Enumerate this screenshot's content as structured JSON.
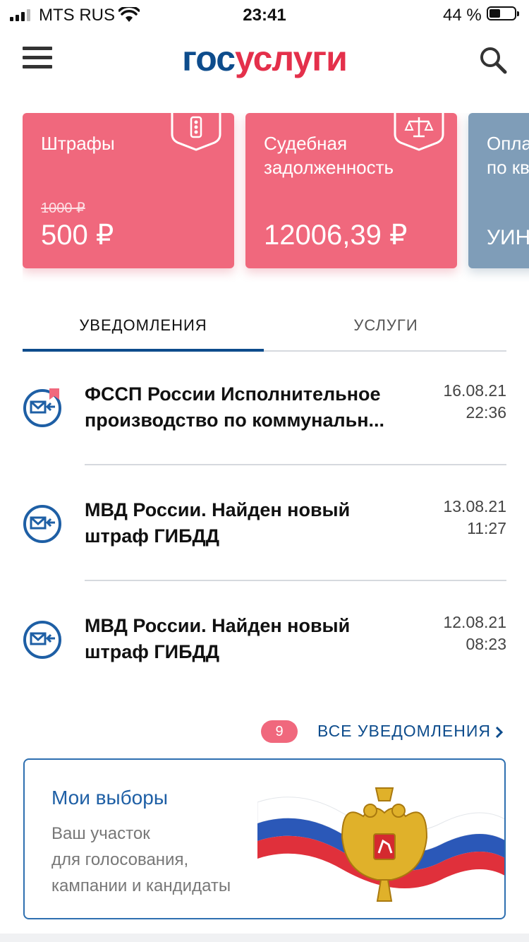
{
  "status_bar": {
    "carrier": "MTS RUS",
    "time": "23:41",
    "battery_percent": "44 %",
    "battery_level": 0.44
  },
  "header": {
    "logo_part1": "гос",
    "logo_part2": "услуги",
    "icons": [
      "menu-icon",
      "search-icon"
    ]
  },
  "cards": [
    {
      "title": "Штрафы",
      "old_amount": "1000 ₽",
      "amount": "500 ₽",
      "icon": "traffic-light-icon",
      "color": "#f0687d"
    },
    {
      "title": "Судебная задолженность",
      "amount": "12006,39 ₽",
      "icon": "scales-icon",
      "color": "#f0687d"
    },
    {
      "title": "Опла по кв",
      "amount": "УИН",
      "color": "#7f9db8"
    }
  ],
  "tabs": [
    {
      "label": "УВЕДОМЛЕНИЯ",
      "active": true
    },
    {
      "label": "УСЛУГИ",
      "active": false
    }
  ],
  "notifications": [
    {
      "title_line1": "ФССП России Исполнительное",
      "title_line2": "производство по коммунальн...",
      "date": "16.08.21",
      "time": "22:36",
      "unread": true
    },
    {
      "title_line1": "МВД России. Найден новый",
      "title_line2": "штраф ГИБДД",
      "date": "13.08.21",
      "time": "11:27",
      "unread": false
    },
    {
      "title_line1": "МВД России. Найден новый",
      "title_line2": "штраф ГИБДД",
      "date": "12.08.21",
      "time": "08:23",
      "unread": false
    }
  ],
  "all_notifications": {
    "count": "9",
    "label": "ВСЕ УВЕДОМЛЕНИЯ"
  },
  "banner": {
    "title": "Мои выборы",
    "subtitle": "Ваш участок\nдля голосования,\nкампании и кандидаты"
  },
  "colors": {
    "brand_blue": "#0d4c8c",
    "accent_red": "#e4304b",
    "card_pink": "#f0687d"
  }
}
